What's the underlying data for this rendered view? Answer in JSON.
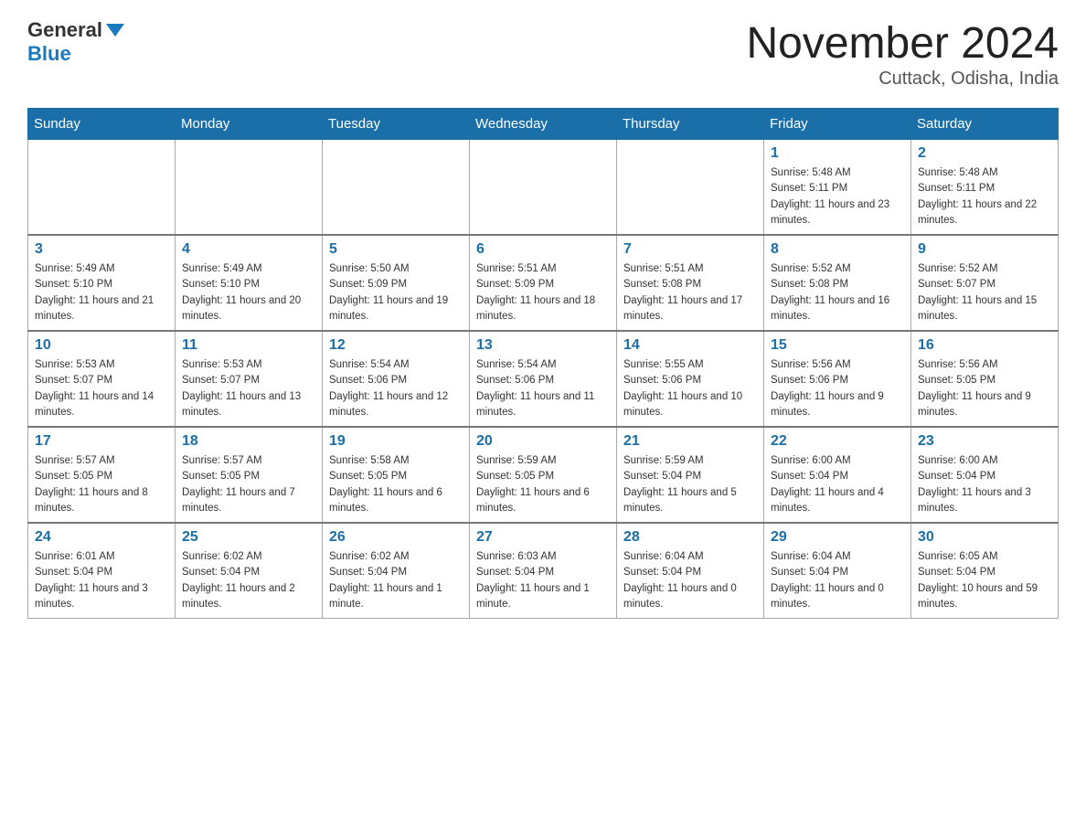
{
  "logo": {
    "general": "General",
    "blue": "Blue"
  },
  "header": {
    "title": "November 2024",
    "subtitle": "Cuttack, Odisha, India"
  },
  "weekdays": [
    "Sunday",
    "Monday",
    "Tuesday",
    "Wednesday",
    "Thursday",
    "Friday",
    "Saturday"
  ],
  "weeks": [
    [
      {
        "day": "",
        "info": ""
      },
      {
        "day": "",
        "info": ""
      },
      {
        "day": "",
        "info": ""
      },
      {
        "day": "",
        "info": ""
      },
      {
        "day": "",
        "info": ""
      },
      {
        "day": "1",
        "info": "Sunrise: 5:48 AM\nSunset: 5:11 PM\nDaylight: 11 hours and 23 minutes."
      },
      {
        "day": "2",
        "info": "Sunrise: 5:48 AM\nSunset: 5:11 PM\nDaylight: 11 hours and 22 minutes."
      }
    ],
    [
      {
        "day": "3",
        "info": "Sunrise: 5:49 AM\nSunset: 5:10 PM\nDaylight: 11 hours and 21 minutes."
      },
      {
        "day": "4",
        "info": "Sunrise: 5:49 AM\nSunset: 5:10 PM\nDaylight: 11 hours and 20 minutes."
      },
      {
        "day": "5",
        "info": "Sunrise: 5:50 AM\nSunset: 5:09 PM\nDaylight: 11 hours and 19 minutes."
      },
      {
        "day": "6",
        "info": "Sunrise: 5:51 AM\nSunset: 5:09 PM\nDaylight: 11 hours and 18 minutes."
      },
      {
        "day": "7",
        "info": "Sunrise: 5:51 AM\nSunset: 5:08 PM\nDaylight: 11 hours and 17 minutes."
      },
      {
        "day": "8",
        "info": "Sunrise: 5:52 AM\nSunset: 5:08 PM\nDaylight: 11 hours and 16 minutes."
      },
      {
        "day": "9",
        "info": "Sunrise: 5:52 AM\nSunset: 5:07 PM\nDaylight: 11 hours and 15 minutes."
      }
    ],
    [
      {
        "day": "10",
        "info": "Sunrise: 5:53 AM\nSunset: 5:07 PM\nDaylight: 11 hours and 14 minutes."
      },
      {
        "day": "11",
        "info": "Sunrise: 5:53 AM\nSunset: 5:07 PM\nDaylight: 11 hours and 13 minutes."
      },
      {
        "day": "12",
        "info": "Sunrise: 5:54 AM\nSunset: 5:06 PM\nDaylight: 11 hours and 12 minutes."
      },
      {
        "day": "13",
        "info": "Sunrise: 5:54 AM\nSunset: 5:06 PM\nDaylight: 11 hours and 11 minutes."
      },
      {
        "day": "14",
        "info": "Sunrise: 5:55 AM\nSunset: 5:06 PM\nDaylight: 11 hours and 10 minutes."
      },
      {
        "day": "15",
        "info": "Sunrise: 5:56 AM\nSunset: 5:06 PM\nDaylight: 11 hours and 9 minutes."
      },
      {
        "day": "16",
        "info": "Sunrise: 5:56 AM\nSunset: 5:05 PM\nDaylight: 11 hours and 9 minutes."
      }
    ],
    [
      {
        "day": "17",
        "info": "Sunrise: 5:57 AM\nSunset: 5:05 PM\nDaylight: 11 hours and 8 minutes."
      },
      {
        "day": "18",
        "info": "Sunrise: 5:57 AM\nSunset: 5:05 PM\nDaylight: 11 hours and 7 minutes."
      },
      {
        "day": "19",
        "info": "Sunrise: 5:58 AM\nSunset: 5:05 PM\nDaylight: 11 hours and 6 minutes."
      },
      {
        "day": "20",
        "info": "Sunrise: 5:59 AM\nSunset: 5:05 PM\nDaylight: 11 hours and 6 minutes."
      },
      {
        "day": "21",
        "info": "Sunrise: 5:59 AM\nSunset: 5:04 PM\nDaylight: 11 hours and 5 minutes."
      },
      {
        "day": "22",
        "info": "Sunrise: 6:00 AM\nSunset: 5:04 PM\nDaylight: 11 hours and 4 minutes."
      },
      {
        "day": "23",
        "info": "Sunrise: 6:00 AM\nSunset: 5:04 PM\nDaylight: 11 hours and 3 minutes."
      }
    ],
    [
      {
        "day": "24",
        "info": "Sunrise: 6:01 AM\nSunset: 5:04 PM\nDaylight: 11 hours and 3 minutes."
      },
      {
        "day": "25",
        "info": "Sunrise: 6:02 AM\nSunset: 5:04 PM\nDaylight: 11 hours and 2 minutes."
      },
      {
        "day": "26",
        "info": "Sunrise: 6:02 AM\nSunset: 5:04 PM\nDaylight: 11 hours and 1 minute."
      },
      {
        "day": "27",
        "info": "Sunrise: 6:03 AM\nSunset: 5:04 PM\nDaylight: 11 hours and 1 minute."
      },
      {
        "day": "28",
        "info": "Sunrise: 6:04 AM\nSunset: 5:04 PM\nDaylight: 11 hours and 0 minutes."
      },
      {
        "day": "29",
        "info": "Sunrise: 6:04 AM\nSunset: 5:04 PM\nDaylight: 11 hours and 0 minutes."
      },
      {
        "day": "30",
        "info": "Sunrise: 6:05 AM\nSunset: 5:04 PM\nDaylight: 10 hours and 59 minutes."
      }
    ]
  ]
}
